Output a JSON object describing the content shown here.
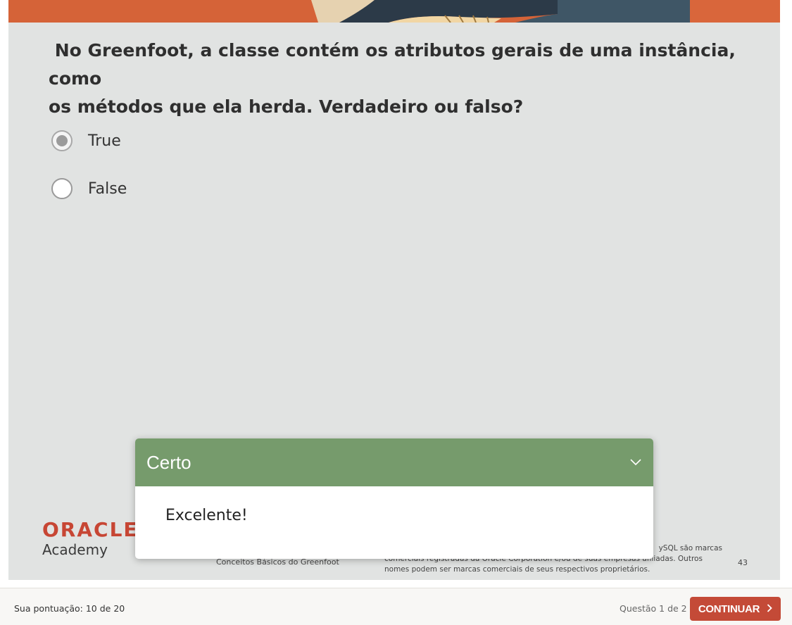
{
  "question": {
    "text": " No Greenfoot, a classe contém os atributos gerais de uma instância, como\nos métodos que ela herda. Verdadeiro ou falso?"
  },
  "options": [
    {
      "label": "True",
      "selected": true
    },
    {
      "label": "False",
      "selected": false
    }
  ],
  "footer": {
    "logo_word": "ORACLE",
    "logo_sub": "Academy",
    "course": "Conceitos Básicos do Greenfoot",
    "legal_line1": "ySQL são marcas",
    "legal_line2": "comerciais registradas da Oracle Corporation e/ou de suas empresas afiliadas. Outros",
    "legal_line3": "nomes podem ser marcas comerciais de seus respectivos proprietários.",
    "page_number": "43"
  },
  "feedback": {
    "title": "Certo",
    "message": "Excelente!",
    "header_color": "#769b6c",
    "icon": "chevron-down-icon"
  },
  "bottom_bar": {
    "score": "Sua pontuação: 10 de 20",
    "question_counter": "Questão 1 de 2",
    "continue_label": "CONTINUAR",
    "continue_color": "#c44a37"
  }
}
